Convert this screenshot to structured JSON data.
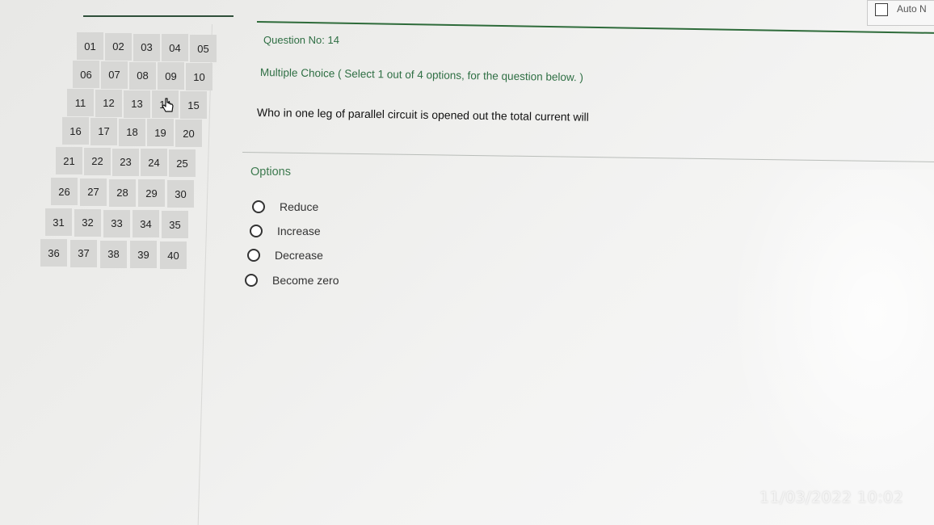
{
  "question_nav": {
    "numbers": [
      "01",
      "02",
      "03",
      "04",
      "05",
      "06",
      "07",
      "08",
      "09",
      "10",
      "11",
      "12",
      "13",
      "14",
      "15",
      "16",
      "17",
      "18",
      "19",
      "20",
      "21",
      "22",
      "23",
      "24",
      "25",
      "26",
      "27",
      "28",
      "29",
      "30",
      "31",
      "32",
      "33",
      "34",
      "35",
      "36",
      "37",
      "38",
      "39",
      "40"
    ]
  },
  "header": {
    "auto_next_label": "Auto N"
  },
  "question": {
    "number_label": "Question No: 14",
    "type_label": "Multiple Choice ( Select 1 out of 4 options, for the question below. )",
    "text": "Who in one leg of parallel circuit is opened out the total current will"
  },
  "options": {
    "heading": "Options",
    "items": [
      "Reduce",
      "Increase",
      "Decrease",
      "Become zero"
    ]
  },
  "overlay": {
    "timestamp": "11/03/2022 10:02"
  },
  "colors": {
    "accent_green": "#2f6f44",
    "cell_bg": "#d7d7d5"
  },
  "icons": {
    "cursor": "hand-pointer-icon"
  }
}
